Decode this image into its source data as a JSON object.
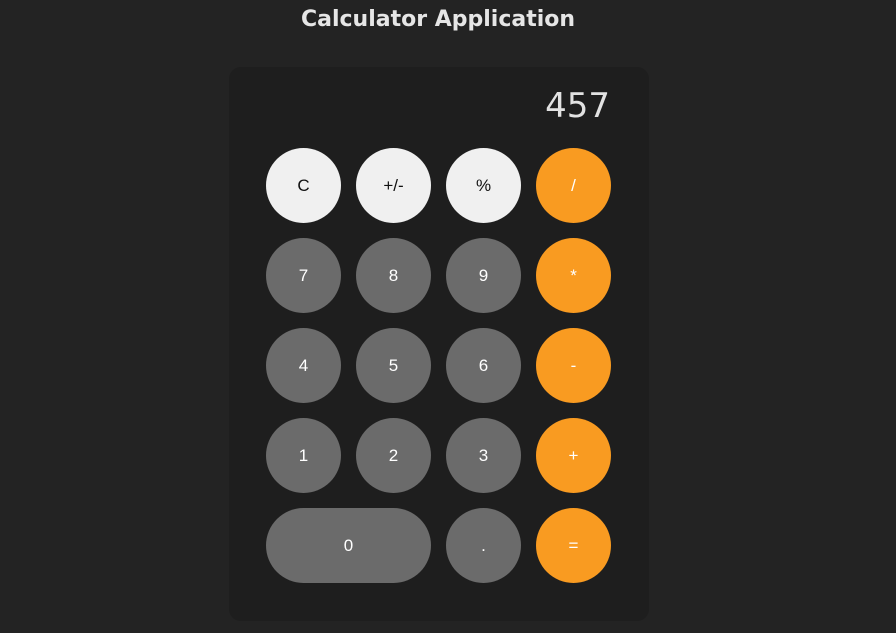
{
  "header": {
    "title": "Calculator Application"
  },
  "display": {
    "value": "457"
  },
  "colors": {
    "background": "#232323",
    "panel": "#1e1e1e",
    "number_key": "#6b6b6b",
    "function_key": "#f0f0f0",
    "operator_key": "#f99b21"
  },
  "keys": {
    "clear": "C",
    "plus_minus": "+/-",
    "percent": "%",
    "divide": "/",
    "seven": "7",
    "eight": "8",
    "nine": "9",
    "multiply": "*",
    "four": "4",
    "five": "5",
    "six": "6",
    "subtract": "-",
    "one": "1",
    "two": "2",
    "three": "3",
    "add": "+",
    "zero": "0",
    "decimal": ".",
    "equals": "="
  }
}
